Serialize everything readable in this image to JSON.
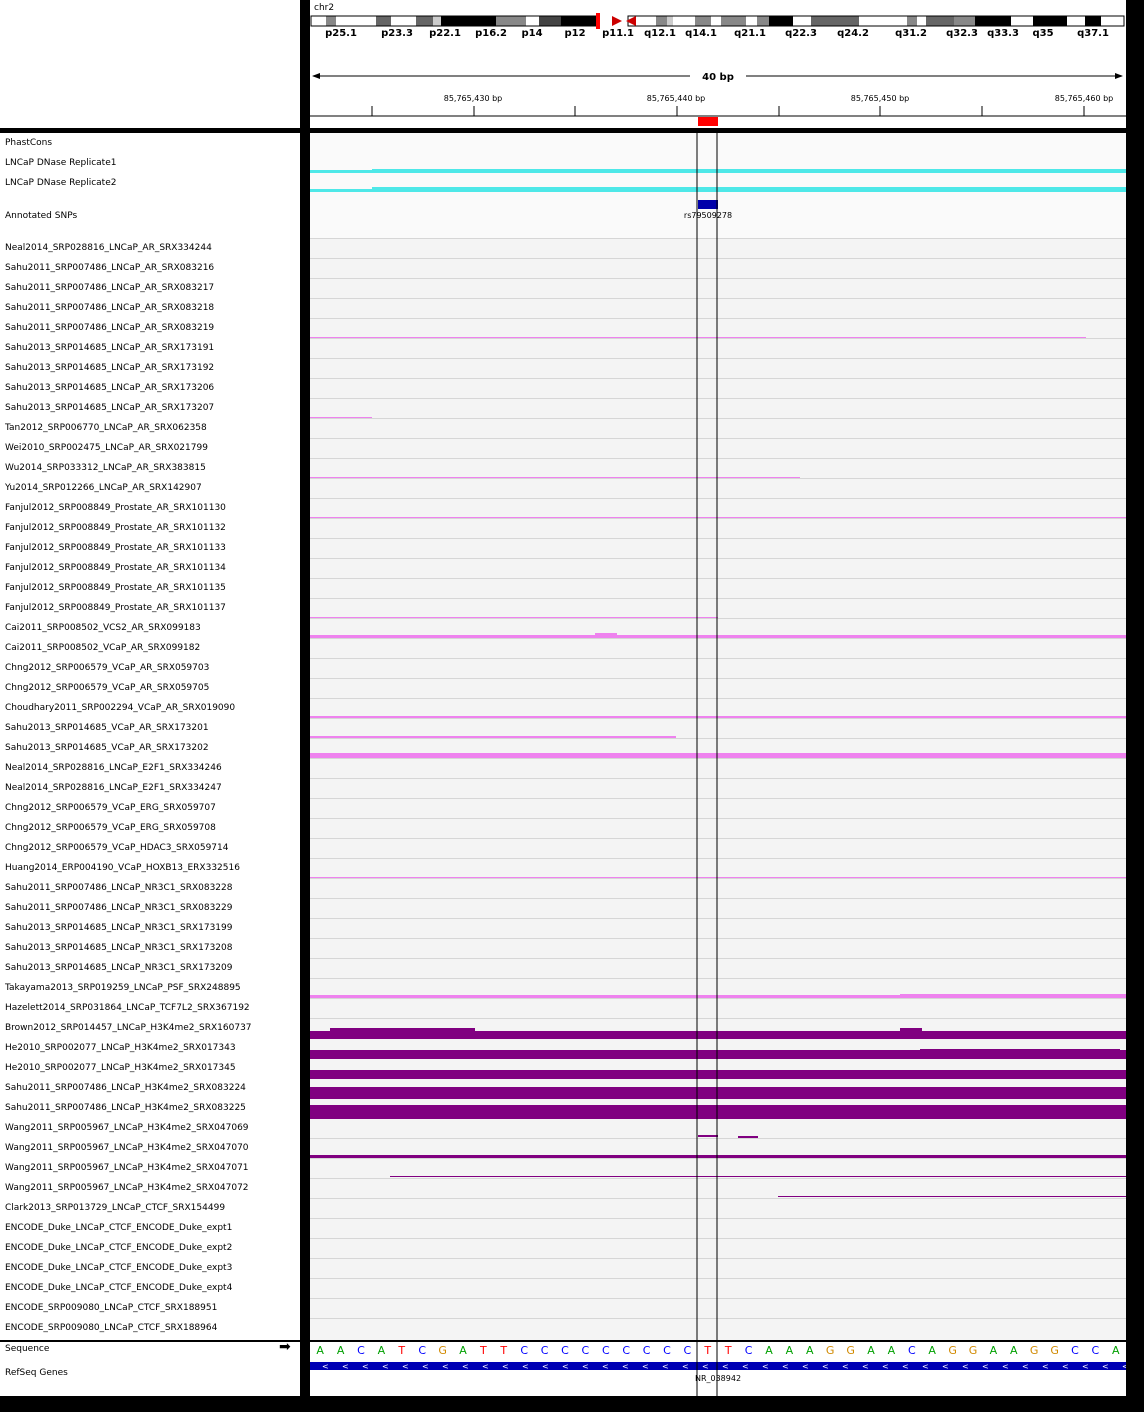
{
  "chromosome": "chr2",
  "bands": [
    "p25.1",
    "p23.3",
    "p22.1",
    "p16.2",
    "p14",
    "p12",
    "p11.1",
    "q12.1",
    "q14.1",
    "q21.1",
    "q22.3",
    "q24.2",
    "q31.2",
    "q32.3",
    "q33.3",
    "q35",
    "q37.1"
  ],
  "span_label": "40 bp",
  "ruler_ticks": [
    "85,765,430 bp",
    "85,765,440 bp",
    "85,765,450 bp",
    "85,765,460 bp"
  ],
  "tracks": [
    "PhastCons",
    "LNCaP DNase Replicate1",
    "LNCaP DNase Replicate2",
    "Annotated SNPs",
    "Neal2014_SRP028816_LNCaP_AR_SRX334244",
    "Sahu2011_SRP007486_LNCaP_AR_SRX083216",
    "Sahu2011_SRP007486_LNCaP_AR_SRX083217",
    "Sahu2011_SRP007486_LNCaP_AR_SRX083218",
    "Sahu2011_SRP007486_LNCaP_AR_SRX083219",
    "Sahu2013_SRP014685_LNCaP_AR_SRX173191",
    "Sahu2013_SRP014685_LNCaP_AR_SRX173192",
    "Sahu2013_SRP014685_LNCaP_AR_SRX173206",
    "Sahu2013_SRP014685_LNCaP_AR_SRX173207",
    "Tan2012_SRP006770_LNCaP_AR_SRX062358",
    "Wei2010_SRP002475_LNCaP_AR_SRX021799",
    "Wu2014_SRP033312_LNCaP_AR_SRX383815",
    "Yu2014_SRP012266_LNCaP_AR_SRX142907",
    "Fanjul2012_SRP008849_Prostate_AR_SRX101130",
    "Fanjul2012_SRP008849_Prostate_AR_SRX101132",
    "Fanjul2012_SRP008849_Prostate_AR_SRX101133",
    "Fanjul2012_SRP008849_Prostate_AR_SRX101134",
    "Fanjul2012_SRP008849_Prostate_AR_SRX101135",
    "Fanjul2012_SRP008849_Prostate_AR_SRX101137",
    "Cai2011_SRP008502_VCS2_AR_SRX099183",
    "Cai2011_SRP008502_VCaP_AR_SRX099182",
    "Chng2012_SRP006579_VCaP_AR_SRX059703",
    "Chng2012_SRP006579_VCaP_AR_SRX059705",
    "Choudhary2011_SRP002294_VCaP_AR_SRX019090",
    "Sahu2013_SRP014685_VCaP_AR_SRX173201",
    "Sahu2013_SRP014685_VCaP_AR_SRX173202",
    "Neal2014_SRP028816_LNCaP_E2F1_SRX334246",
    "Neal2014_SRP028816_LNCaP_E2F1_SRX334247",
    "Chng2012_SRP006579_VCaP_ERG_SRX059707",
    "Chng2012_SRP006579_VCaP_ERG_SRX059708",
    "Chng2012_SRP006579_VCaP_HDAC3_SRX059714",
    "Huang2014_ERP004190_VCaP_HOXB13_ERX332516",
    "Sahu2011_SRP007486_LNCaP_NR3C1_SRX083228",
    "Sahu2011_SRP007486_LNCaP_NR3C1_SRX083229",
    "Sahu2013_SRP014685_LNCaP_NR3C1_SRX173199",
    "Sahu2013_SRP014685_LNCaP_NR3C1_SRX173208",
    "Sahu2013_SRP014685_LNCaP_NR3C1_SRX173209",
    "Takayama2013_SRP019259_LNCaP_PSF_SRX248895",
    "Hazelett2014_SRP031864_LNCaP_TCF7L2_SRX367192",
    "Brown2012_SRP014457_LNCaP_H3K4me2_SRX160737",
    "He2010_SRP002077_LNCaP_H3K4me2_SRX017343",
    "He2010_SRP002077_LNCaP_H3K4me2_SRX017345",
    "Sahu2011_SRP007486_LNCaP_H3K4me2_SRX083224",
    "Sahu2011_SRP007486_LNCaP_H3K4me2_SRX083225",
    "Wang2011_SRP005967_LNCaP_H3K4me2_SRX047069",
    "Wang2011_SRP005967_LNCaP_H3K4me2_SRX047070",
    "Wang2011_SRP005967_LNCaP_H3K4me2_SRX047071",
    "Wang2011_SRP005967_LNCaP_H3K4me2_SRX047072",
    "Clark2013_SRP013729_LNCaP_CTCF_SRX154499",
    "ENCODE_Duke_LNCaP_CTCF_ENCODE_Duke_expt1",
    "ENCODE_Duke_LNCaP_CTCF_ENCODE_Duke_expt2",
    "ENCODE_Duke_LNCaP_CTCF_ENCODE_Duke_expt3",
    "ENCODE_Duke_LNCaP_CTCF_ENCODE_Duke_expt4",
    "ENCODE_SRP009080_LNCaP_CTCF_SRX188951",
    "ENCODE_SRP009080_LNCaP_CTCF_SRX188964"
  ],
  "snp_label": "rs79509278",
  "sequence_label": "Sequence",
  "sequence_arrow": "➡",
  "sequence": [
    "A",
    "A",
    "C",
    "A",
    "T",
    "C",
    "G",
    "A",
    "T",
    "T",
    "C",
    "C",
    "C",
    "C",
    "C",
    "C",
    "C",
    "C",
    "C",
    "T",
    "T",
    "C",
    "A",
    "A",
    "A",
    "G",
    "G",
    "A",
    "A",
    "C",
    "A",
    "G",
    "G",
    "A",
    "A",
    "G",
    "G",
    "C",
    "C",
    "A"
  ],
  "refseq_label": "RefSeq Genes",
  "gene_label": "NR_038942",
  "strand_glyph": "<",
  "colors": {
    "dnase": "#4ee8e8",
    "tf": "#ee82ee",
    "histone": "#800080",
    "snp": "#0000aa",
    "gene": "#0000b4",
    "base_A": "#00a000",
    "base_C": "#0000ff",
    "base_G": "#d18a00",
    "base_T": "#ff0000"
  }
}
